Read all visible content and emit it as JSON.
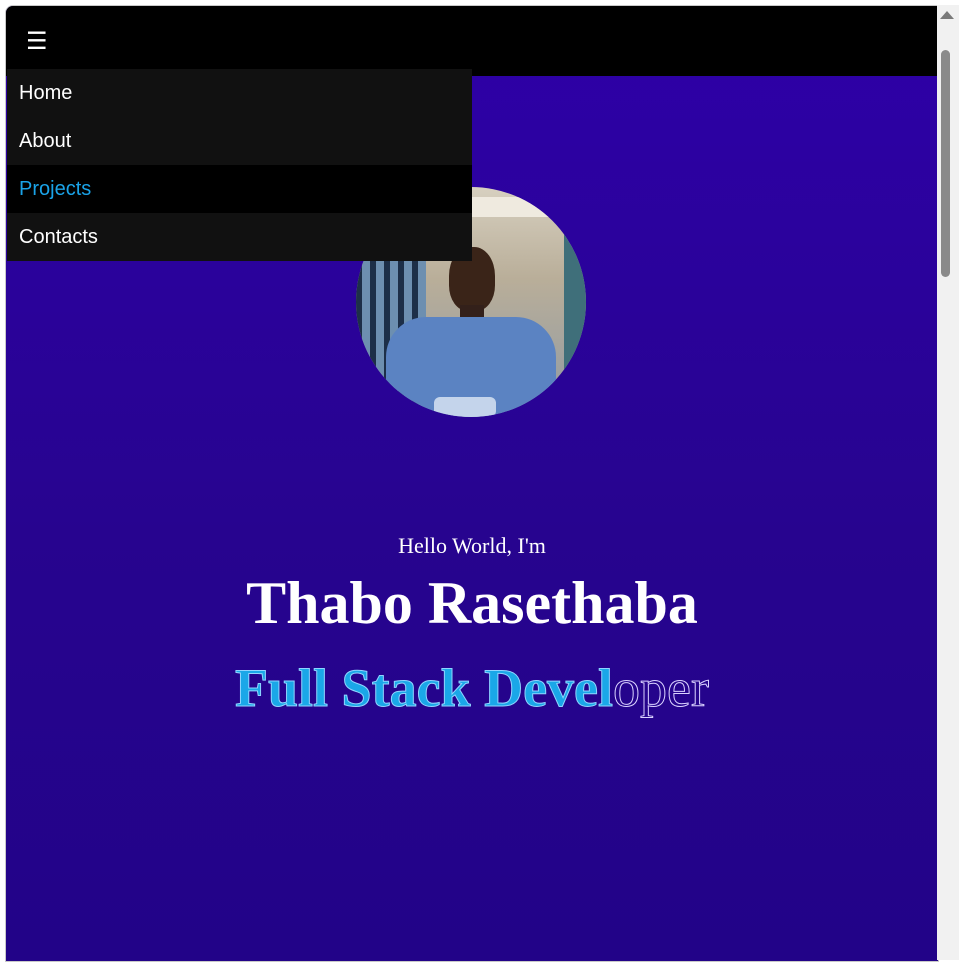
{
  "nav": {
    "menu_icon": "hamburger-icon",
    "menu_glyph": "☰",
    "items": [
      {
        "label": "Home",
        "active": false
      },
      {
        "label": "About",
        "active": false
      },
      {
        "label": "Projects",
        "active": true
      },
      {
        "label": "Contacts",
        "active": false
      }
    ]
  },
  "hero": {
    "greeting": "Hello World, I'm",
    "name": "Thabo Rasethaba",
    "role_typed": "Full Stack Devel",
    "role_rest": "oper",
    "portrait_alt": "portrait photo"
  },
  "colors": {
    "background_top": "#2e00a8",
    "background_bottom": "#220388",
    "navbar": "#000000",
    "menu": "#111111",
    "accent": "#1aa3e8"
  }
}
